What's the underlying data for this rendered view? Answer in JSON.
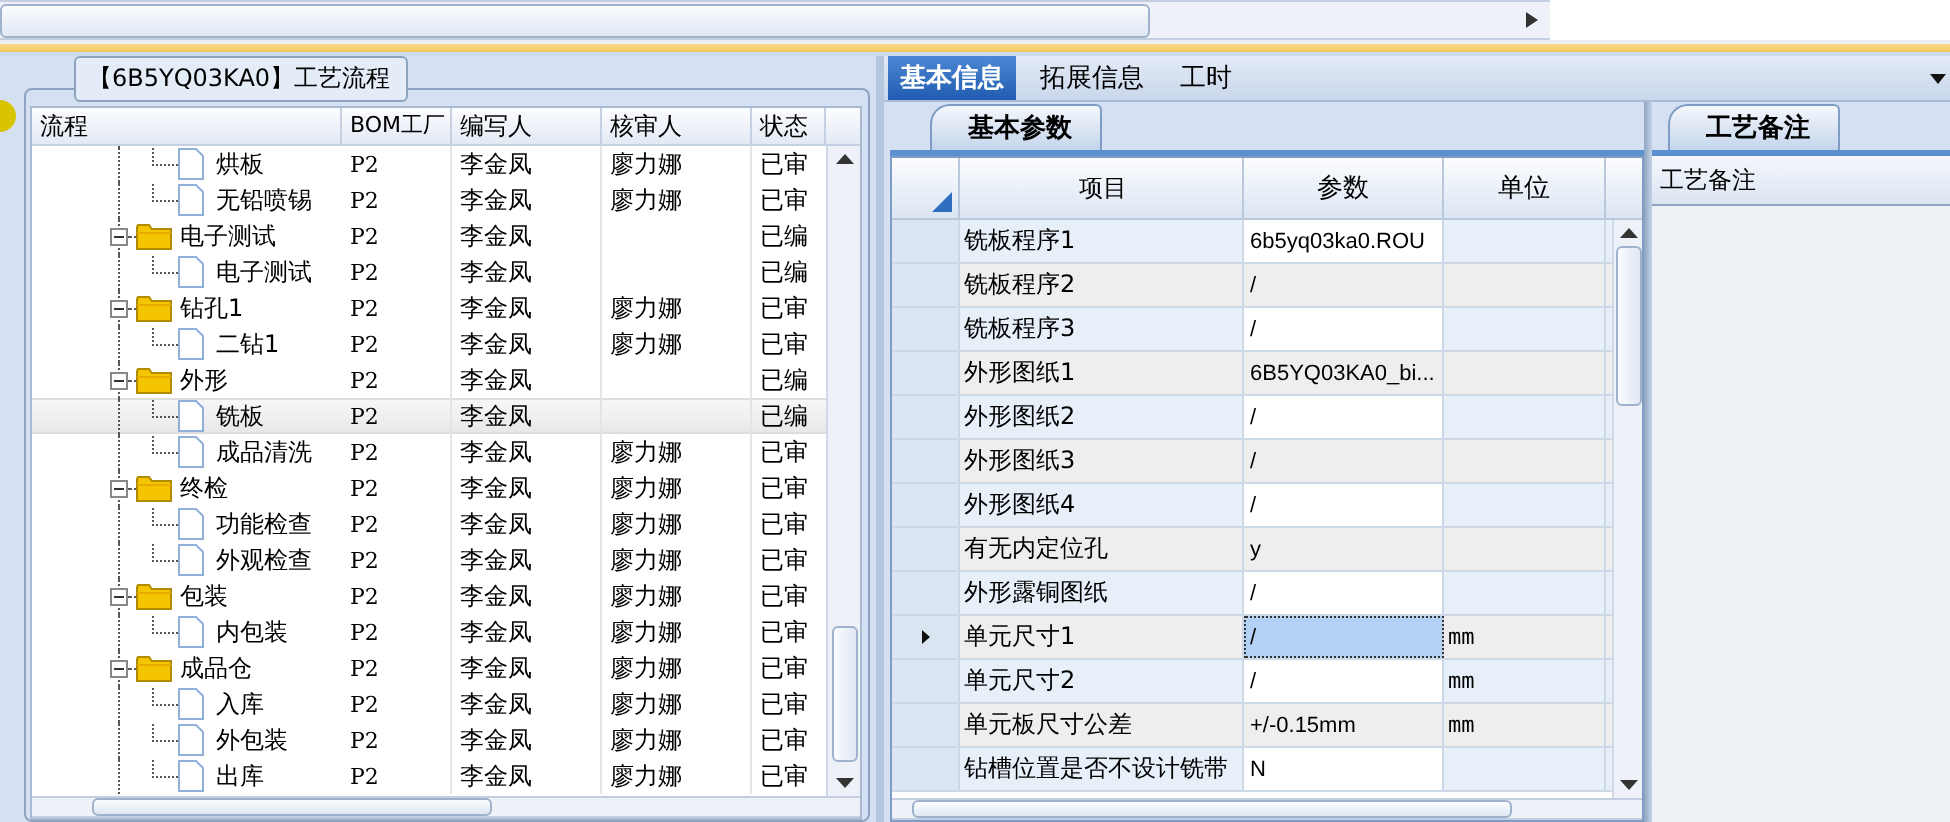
{
  "flow_panel": {
    "title": "【6B5YQ03KA0】工艺流程",
    "columns": [
      "流程",
      "BOM工厂",
      "编写人",
      "核审人",
      "状态"
    ],
    "rows": [
      {
        "kind": "leaf",
        "name": "烘板",
        "bom": "P2",
        "author": "李金凤",
        "reviewer": "廖力娜",
        "status": "已审",
        "selected": false
      },
      {
        "kind": "leaf",
        "name": "无铅喷锡",
        "bom": "P2",
        "author": "李金凤",
        "reviewer": "廖力娜",
        "status": "已审",
        "selected": false
      },
      {
        "kind": "folder",
        "name": "电子测试",
        "bom": "P2",
        "author": "李金凤",
        "status": "已编",
        "selected": false,
        "expanded": true,
        "children": [
          {
            "kind": "leaf",
            "name": "电子测试",
            "bom": "P2",
            "author": "李金凤",
            "status": "已编",
            "selected": false
          }
        ]
      },
      {
        "kind": "folder",
        "name": "钻孔1",
        "bom": "P2",
        "author": "李金凤",
        "reviewer": "廖力娜",
        "status": "已审",
        "selected": false,
        "expanded": true,
        "children": [
          {
            "kind": "leaf",
            "name": "二钻1",
            "bom": "P2",
            "author": "李金凤",
            "reviewer": "廖力娜",
            "status": "已审",
            "selected": false
          }
        ]
      },
      {
        "kind": "folder",
        "name": "外形",
        "bom": "P2",
        "author": "李金凤",
        "status": "已编",
        "selected": false,
        "expanded": true,
        "children": [
          {
            "kind": "leaf",
            "name": "铣板",
            "bom": "P2",
            "author": "李金凤",
            "status": "已编",
            "selected": true
          },
          {
            "kind": "leaf",
            "name": "成品清洗",
            "bom": "P2",
            "author": "李金凤",
            "reviewer": "廖力娜",
            "status": "已审",
            "selected": false
          }
        ]
      },
      {
        "kind": "folder",
        "name": "终检",
        "bom": "P2",
        "author": "李金凤",
        "reviewer": "廖力娜",
        "status": "已审",
        "selected": false,
        "expanded": true,
        "children": [
          {
            "kind": "leaf",
            "name": "功能检查",
            "bom": "P2",
            "author": "李金凤",
            "reviewer": "廖力娜",
            "status": "已审",
            "selected": false
          },
          {
            "kind": "leaf",
            "name": "外观检查",
            "bom": "P2",
            "author": "李金凤",
            "reviewer": "廖力娜",
            "status": "已审",
            "selected": false
          }
        ]
      },
      {
        "kind": "folder",
        "name": "包装",
        "bom": "P2",
        "author": "李金凤",
        "reviewer": "廖力娜",
        "status": "已审",
        "selected": false,
        "expanded": true,
        "children": [
          {
            "kind": "leaf",
            "name": "内包装",
            "bom": "P2",
            "author": "李金凤",
            "reviewer": "廖力娜",
            "status": "已审",
            "selected": false
          }
        ]
      },
      {
        "kind": "folder",
        "name": "成品仓",
        "bom": "P2",
        "author": "李金凤",
        "reviewer": "廖力娜",
        "status": "已审",
        "selected": false,
        "expanded": true,
        "children": [
          {
            "kind": "leaf",
            "name": "入库",
            "bom": "P2",
            "author": "李金凤",
            "reviewer": "廖力娜",
            "status": "已审",
            "selected": false
          },
          {
            "kind": "leaf",
            "name": "外包装",
            "bom": "P2",
            "author": "李金凤",
            "reviewer": "廖力娜",
            "status": "已审",
            "selected": false
          },
          {
            "kind": "leaf",
            "name": "出库",
            "bom": "P2",
            "author": "李金凤",
            "reviewer": "廖力娜",
            "status": "已审",
            "selected": false
          }
        ]
      }
    ]
  },
  "detail_panel": {
    "tabs": [
      {
        "label": "基本信息",
        "selected": true
      },
      {
        "label": "拓展信息",
        "selected": false
      },
      {
        "label": "工时",
        "selected": false
      }
    ],
    "subtab": "基本参数",
    "grid": {
      "columns": [
        "项目",
        "参数",
        "单位"
      ],
      "rows": [
        {
          "item": "铣板程序1",
          "value": "6b5yq03ka0.ROU",
          "current": false
        },
        {
          "item": "铣板程序2",
          "value": "/",
          "current": false
        },
        {
          "item": "铣板程序3",
          "value": "/",
          "current": false
        },
        {
          "item": "外形图纸1",
          "value": "6B5YQ03KA0_bi...",
          "current": false
        },
        {
          "item": "外形图纸2",
          "value": "/",
          "current": false
        },
        {
          "item": "外形图纸3",
          "value": "/",
          "current": false
        },
        {
          "item": "外形图纸4",
          "value": "/",
          "current": false
        },
        {
          "item": "有无内定位孔",
          "value": "y",
          "current": false
        },
        {
          "item": "外形露铜图纸",
          "value": "/",
          "current": false
        },
        {
          "item": "单元尺寸1",
          "value": "/",
          "unit": "mm",
          "current": true
        },
        {
          "item": "单元尺寸2",
          "value": "/",
          "unit": "mm",
          "current": false
        },
        {
          "item": "单元板尺寸公差",
          "value": "+/-0.15mm",
          "unit": "mm",
          "current": false
        },
        {
          "item": "钻槽位置是否不设计铣带",
          "value": "N",
          "current": false
        }
      ]
    }
  },
  "notes_panel": {
    "tab": "工艺备注",
    "header": "工艺备注"
  }
}
